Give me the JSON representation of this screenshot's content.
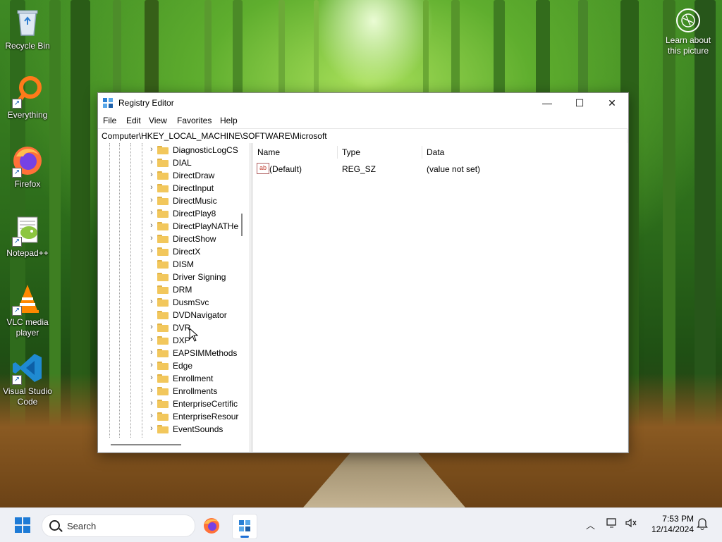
{
  "desktop": {
    "icons": [
      {
        "label": "Recycle Bin",
        "icon": "recycle-bin-icon"
      },
      {
        "label": "Everything",
        "icon": "everything-search-icon"
      },
      {
        "label": "Firefox",
        "icon": "firefox-icon"
      },
      {
        "label": "Notepad++",
        "icon": "notepadpp-icon"
      },
      {
        "label": "VLC media player",
        "icon": "vlc-icon"
      },
      {
        "label": "Visual Studio Code",
        "icon": "vscode-icon"
      }
    ],
    "learn_label": "Learn about this picture"
  },
  "window": {
    "title": "Registry Editor",
    "controls": {
      "minimize": "—",
      "maximize": "☐",
      "close": "✕"
    },
    "menu": [
      "File",
      "Edit",
      "View",
      "Favorites",
      "Help"
    ],
    "address": "Computer\\HKEY_LOCAL_MACHINE\\SOFTWARE\\Microsoft",
    "tree": [
      {
        "label": "DiagnosticLogCS",
        "expandable": true
      },
      {
        "label": "DIAL",
        "expandable": true
      },
      {
        "label": "DirectDraw",
        "expandable": true
      },
      {
        "label": "DirectInput",
        "expandable": true
      },
      {
        "label": "DirectMusic",
        "expandable": true
      },
      {
        "label": "DirectPlay8",
        "expandable": true
      },
      {
        "label": "DirectPlayNATHe",
        "expandable": true
      },
      {
        "label": "DirectShow",
        "expandable": true
      },
      {
        "label": "DirectX",
        "expandable": true
      },
      {
        "label": "DISM",
        "expandable": false
      },
      {
        "label": "Driver Signing",
        "expandable": false
      },
      {
        "label": "DRM",
        "expandable": false
      },
      {
        "label": "DusmSvc",
        "expandable": true
      },
      {
        "label": "DVDNavigator",
        "expandable": false
      },
      {
        "label": "DVR",
        "expandable": true
      },
      {
        "label": "DXP",
        "expandable": true
      },
      {
        "label": "EAPSIMMethods",
        "expandable": true
      },
      {
        "label": "Edge",
        "expandable": true
      },
      {
        "label": "Enrollment",
        "expandable": true
      },
      {
        "label": "Enrollments",
        "expandable": true
      },
      {
        "label": "EnterpriseCertific",
        "expandable": true
      },
      {
        "label": "EnterpriseResour",
        "expandable": true
      },
      {
        "label": "EventSounds",
        "expandable": true
      }
    ],
    "columns": [
      "Name",
      "Type",
      "Data"
    ],
    "values": [
      {
        "name": "(Default)",
        "type": "REG_SZ",
        "data": "(value not set)"
      }
    ]
  },
  "taskbar": {
    "search_placeholder": "Search",
    "apps": [
      "firefox-icon",
      "registry-editor-icon"
    ],
    "time": "7:53 PM",
    "date": "12/14/2024"
  },
  "colors": {
    "accent": "#1d6fd6",
    "folder": "#f2c75c",
    "vscode": "#1f8ad2",
    "firefox": "#ff7139"
  }
}
